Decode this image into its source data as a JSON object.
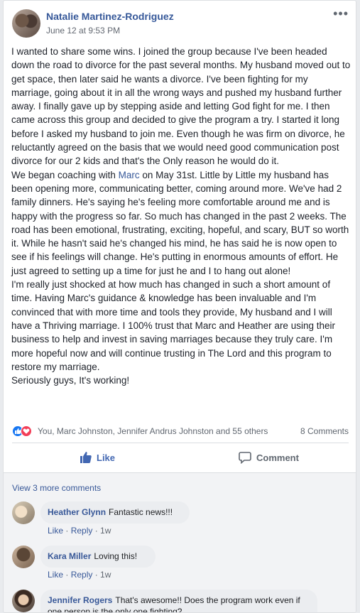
{
  "post": {
    "author": "Natalie Martinez-Rodriguez",
    "timestamp": "June 12 at 9:53 PM",
    "more_icon": "•••",
    "para1": "I wanted to share some wins. I joined the group because I've been headed down the road to divorce for the past several months. My husband moved out to get space, then later said he wants a divorce. I've been fighting for my marriage, going about it in all the wrong ways and pushed my husband further away. I finally gave up by stepping aside and letting God fight for me. I then came across this group and decided to give the program a try. I started it long before I asked my husband to join me. Even though he was firm on divorce, he reluctantly agreed on the basis that we would need good communication post divorce for our 2 kids and that's the Only reason he would do it.",
    "para2_before": "We began coaching with ",
    "para2_mention": "Marc",
    "para2_after": " on May 31st. Little by Little my husband has been opening more, communicating better, coming around more. We've had 2 family dinners. He's saying he's feeling more comfortable around me and is happy with the progress so far. So much has changed in the past 2 weeks. The road has been emotional, frustrating, exciting, hopeful, and scary, BUT so worth it. While he hasn't said he's changed his mind, he has said he is now open to see if his feelings will change. He's putting in enormous amounts of effort. He just agreed to setting up a time for just he and I to hang out alone!",
    "para3": "I'm really just shocked at how much has changed in such a short amount of time. Having Marc's guidance & knowledge has been invaluable and I'm convinced that with more time and tools they provide, My husband and I will have a Thriving marriage. I 100% trust that Marc and Heather are using their business to help and invest in saving marriages because they truly care. I'm more hopeful now and will continue trusting in The Lord and this program to restore my marriage.",
    "para4": "Seriously guys, It's working!"
  },
  "reactions": {
    "names": "You, Marc Johnston, Jennifer Andrus Johnston and 55 others",
    "comments_count": "8 Comments",
    "like_color": "#1877f2",
    "love_color": "#f33e58"
  },
  "actions": {
    "like_label": "Like",
    "comment_label": "Comment",
    "accent": "#4267b2"
  },
  "comments": {
    "view_more": "View 3 more comments",
    "items": [
      {
        "name": "Heather Glynn",
        "text": "Fantastic news!!!",
        "like": "Like",
        "reply": "Reply",
        "time": "1w"
      },
      {
        "name": "Kara Miller",
        "text": "Loving this!",
        "like": "Like",
        "reply": "Reply",
        "time": "1w"
      },
      {
        "name": "Jennifer Rogers",
        "text": "That's awesome!! Does the program work even if one person is the only one fighting?"
      }
    ]
  }
}
